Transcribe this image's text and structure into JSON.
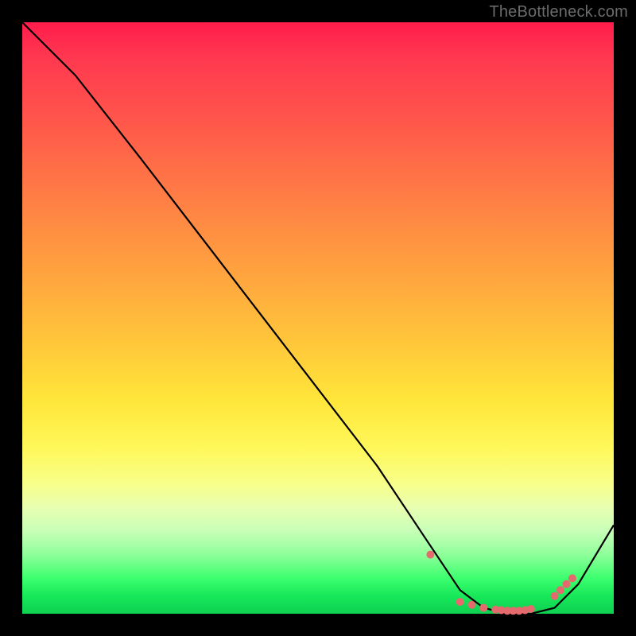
{
  "watermark": "TheBottleneck.com",
  "colors": {
    "curve": "#000000",
    "marker": "#e46a6e",
    "bg_black": "#000000"
  },
  "chart_data": {
    "type": "line",
    "title": "",
    "xlabel": "",
    "ylabel": "",
    "xlim": [
      0,
      100
    ],
    "ylim": [
      0,
      100
    ],
    "grid": false,
    "legend": false,
    "series": [
      {
        "name": "bottleneck-curve",
        "x": [
          0,
          9,
          20,
          30,
          40,
          50,
          60,
          68,
          74,
          78,
          82,
          86,
          90,
          94,
          100
        ],
        "y": [
          100,
          91,
          77,
          64,
          51,
          38,
          25,
          13,
          4,
          1,
          0,
          0,
          1,
          5,
          15
        ]
      }
    ],
    "markers": {
      "name": "highlight-points",
      "x": [
        69,
        74,
        76,
        78,
        80,
        81,
        82,
        83,
        84,
        85,
        86,
        90,
        91,
        92,
        93
      ],
      "y": [
        10,
        2,
        1.5,
        1,
        0.7,
        0.6,
        0.5,
        0.5,
        0.5,
        0.6,
        0.8,
        3,
        4,
        5,
        6
      ]
    }
  }
}
